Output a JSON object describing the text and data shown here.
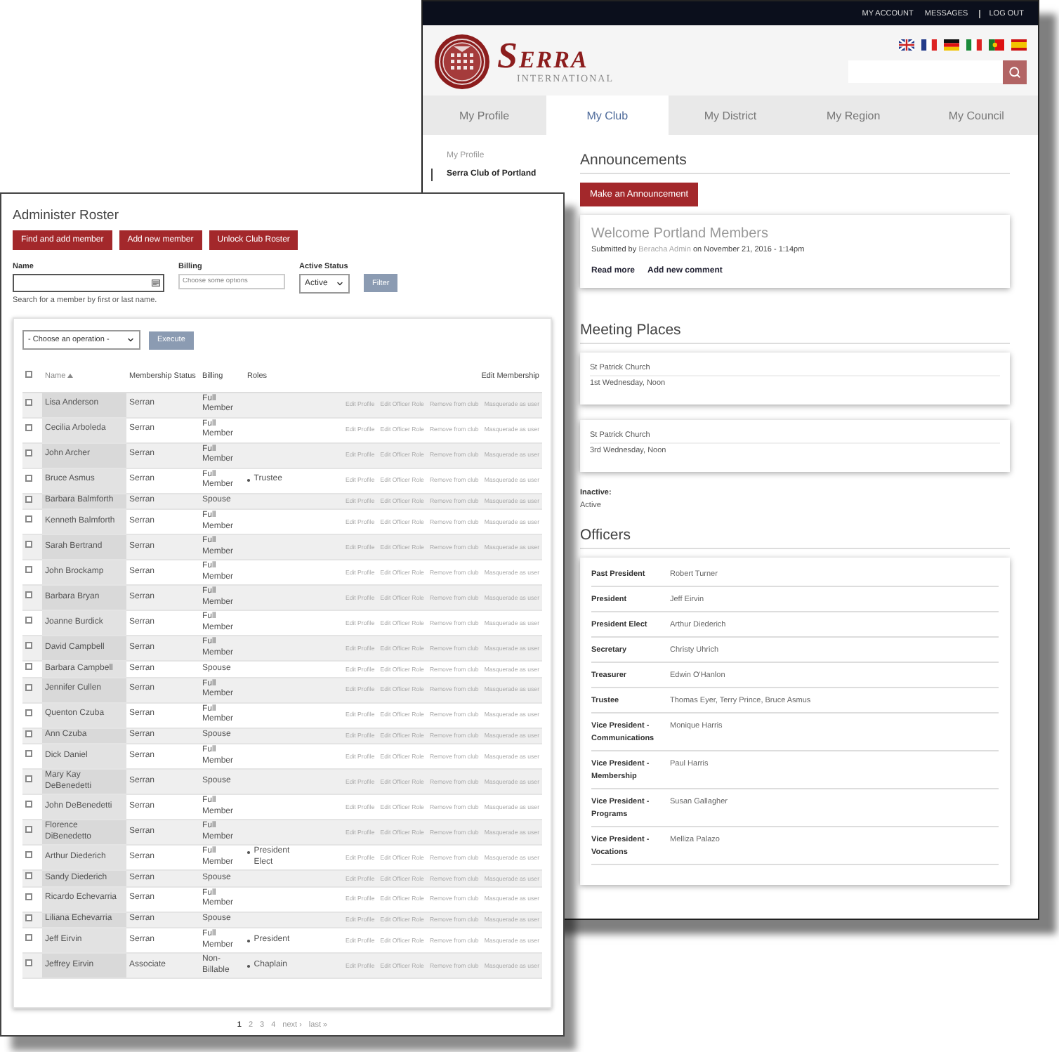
{
  "account_window": {
    "top_links": [
      "MY ACCOUNT",
      "MESSAGES",
      "LOG OUT"
    ],
    "logo": {
      "wordmark": "SERRA",
      "subtitle": "INTERNATIONAL"
    },
    "tabs": [
      {
        "label": "My Profile",
        "selected": false
      },
      {
        "label": "My Club",
        "selected": true
      },
      {
        "label": "My District",
        "selected": false
      },
      {
        "label": "My Region",
        "selected": false
      },
      {
        "label": "My Council",
        "selected": false
      }
    ],
    "sidebar": {
      "items": [
        {
          "label": "My Profile",
          "selected": false
        },
        {
          "label": "Serra Club of Portland",
          "selected": true
        }
      ]
    },
    "announcements": {
      "heading": "Announcements",
      "button": "Make an Announcement",
      "items": [
        {
          "title": "Welcome Portland Members",
          "submitted_prefix": "Submitted by",
          "author": "Beracha Admin",
          "submitted_suffix": "on November 21, 2016 - 1:14pm",
          "links": [
            "Read more",
            "Add new comment"
          ]
        }
      ]
    },
    "meeting_places": {
      "heading": "Meeting Places",
      "items": [
        {
          "place": "St Patrick Church",
          "schedule": "1st Wednesday, Noon"
        },
        {
          "place": "St Patrick Church",
          "schedule": "3rd Wednesday, Noon"
        }
      ]
    },
    "inactive": {
      "label": "Inactive:",
      "value": "Active"
    },
    "officers": {
      "heading": "Officers",
      "items": [
        {
          "role": "Past President",
          "name": "Robert Turner"
        },
        {
          "role": "President",
          "name": "Jeff Eirvin"
        },
        {
          "role": "President Elect",
          "name": "Arthur Diederich"
        },
        {
          "role": "Secretary",
          "name": "Christy Uhrich"
        },
        {
          "role": "Treasurer",
          "name": "Edwin O'Hanlon"
        },
        {
          "role": "Trustee",
          "name": "Thomas Eyer, Terry Prince, Bruce Asmus"
        },
        {
          "role": "Vice President - Communications",
          "name": "Monique Harris"
        },
        {
          "role": "Vice President - Membership",
          "name": "Paul Harris"
        },
        {
          "role": "Vice President - Programs",
          "name": "Susan Gallagher"
        },
        {
          "role": "Vice President - Vocations",
          "name": "Melliza Palazo"
        }
      ]
    }
  },
  "roster_window": {
    "title": "Administer Roster",
    "buttons": [
      "Find and add member",
      "Add new member",
      "Unlock Club Roster"
    ],
    "filters": {
      "name_label": "Name",
      "name_hint": "Search for a member by first or last name.",
      "billing_label": "Billing",
      "billing_placeholder": "Choose some options",
      "status_label": "Active Status",
      "status_value": "Active",
      "filter_button": "Filter"
    },
    "operation": {
      "value": "- Choose an operation -",
      "button": "Execute"
    },
    "table": {
      "select_all_checked": false,
      "columns": [
        {
          "label": "Name",
          "sorted": true
        },
        {
          "label": "Membership Status",
          "sorted": false
        },
        {
          "label": "Billing",
          "sorted": false
        },
        {
          "label": "Roles",
          "sorted": false
        },
        {
          "label": "Edit Membership",
          "sorted": false
        }
      ],
      "rows": [
        {
          "checked": false,
          "name": "Lisa Anderson",
          "status": "Serran",
          "billing": "Full Member",
          "actions": [
            "Edit Profile",
            "Edit Officer Role",
            "Remove from club",
            "Masquerade as user"
          ]
        },
        {
          "checked": false,
          "name": "Cecilia Arboleda",
          "status": "Serran",
          "billing": "Full Member",
          "actions": [
            "Edit Profile",
            "Edit Officer Role",
            "Remove from club",
            "Masquerade as user"
          ]
        },
        {
          "checked": false,
          "name": "John Archer",
          "status": "Serran",
          "billing": "Full Member",
          "actions": [
            "Edit Profile",
            "Edit Officer Role",
            "Remove from club",
            "Masquerade as user"
          ]
        },
        {
          "checked": false,
          "name": "Bruce Asmus",
          "status": "Serran",
          "billing": "Full Member",
          "roles": [
            "Trustee"
          ],
          "actions": [
            "Edit Profile",
            "Edit Officer Role",
            "Remove from club",
            "Masquerade as user"
          ]
        },
        {
          "checked": false,
          "name": "Barbara Balmforth",
          "status": "Serran",
          "billing": "Spouse",
          "actions": [
            "Edit Profile",
            "Edit Officer Role",
            "Remove from club",
            "Masquerade as user"
          ]
        },
        {
          "checked": false,
          "name": "Kenneth Balmforth",
          "status": "Serran",
          "billing": "Full Member",
          "actions": [
            "Edit Profile",
            "Edit Officer Role",
            "Remove from club",
            "Masquerade as user"
          ]
        },
        {
          "checked": false,
          "name": "Sarah Bertrand",
          "status": "Serran",
          "billing": "Full Member",
          "actions": [
            "Edit Profile",
            "Edit Officer Role",
            "Remove from club",
            "Masquerade as user"
          ]
        },
        {
          "checked": false,
          "name": "John Brockamp",
          "status": "Serran",
          "billing": "Full Member",
          "actions": [
            "Edit Profile",
            "Edit Officer Role",
            "Remove from club",
            "Masquerade as user"
          ]
        },
        {
          "checked": false,
          "name": "Barbara Bryan",
          "status": "Serran",
          "billing": "Full Member",
          "actions": [
            "Edit Profile",
            "Edit Officer Role",
            "Remove from club",
            "Masquerade as user"
          ]
        },
        {
          "checked": false,
          "name": "Joanne Burdick",
          "status": "Serran",
          "billing": "Full Member",
          "actions": [
            "Edit Profile",
            "Edit Officer Role",
            "Remove from club",
            "Masquerade as user"
          ]
        },
        {
          "checked": false,
          "name": "David Campbell",
          "status": "Serran",
          "billing": "Full Member",
          "actions": [
            "Edit Profile",
            "Edit Officer Role",
            "Remove from club",
            "Masquerade as user"
          ]
        },
        {
          "checked": false,
          "name": "Barbara Campbell",
          "status": "Serran",
          "billing": "Spouse",
          "actions": [
            "Edit Profile",
            "Edit Officer Role",
            "Remove from club",
            "Masquerade as user"
          ]
        },
        {
          "checked": false,
          "name": "Jennifer Cullen",
          "status": "Serran",
          "billing": "Full Member",
          "actions": [
            "Edit Profile",
            "Edit Officer Role",
            "Remove from club",
            "Masquerade as user"
          ]
        },
        {
          "checked": false,
          "name": "Quenton Czuba",
          "status": "Serran",
          "billing": "Full Member",
          "actions": [
            "Edit Profile",
            "Edit Officer Role",
            "Remove from club",
            "Masquerade as user"
          ]
        },
        {
          "checked": false,
          "name": "Ann Czuba",
          "status": "Serran",
          "billing": "Spouse",
          "actions": [
            "Edit Profile",
            "Edit Officer Role",
            "Remove from club",
            "Masquerade as user"
          ]
        },
        {
          "checked": false,
          "name": "Dick Daniel",
          "status": "Serran",
          "billing": "Full Member",
          "actions": [
            "Edit Profile",
            "Edit Officer Role",
            "Remove from club",
            "Masquerade as user"
          ]
        },
        {
          "checked": false,
          "name": "Mary Kay DeBenedetti",
          "status": "Serran",
          "billing": "Spouse",
          "actions": [
            "Edit Profile",
            "Edit Officer Role",
            "Remove from club",
            "Masquerade as user"
          ]
        },
        {
          "checked": false,
          "name": "John DeBenedetti",
          "status": "Serran",
          "billing": "Full Member",
          "actions": [
            "Edit Profile",
            "Edit Officer Role",
            "Remove from club",
            "Masquerade as user"
          ]
        },
        {
          "checked": false,
          "name": "Florence DiBenedetto",
          "status": "Serran",
          "billing": "Full Member",
          "actions": [
            "Edit Profile",
            "Edit Officer Role",
            "Remove from club",
            "Masquerade as user"
          ]
        },
        {
          "checked": false,
          "name": "Arthur Diederich",
          "status": "Serran",
          "billing": "Full Member",
          "roles": [
            "President Elect"
          ],
          "actions": [
            "Edit Profile",
            "Edit Officer Role",
            "Remove from club",
            "Masquerade as user"
          ]
        },
        {
          "checked": false,
          "name": "Sandy Diederich",
          "status": "Serran",
          "billing": "Spouse",
          "actions": [
            "Edit Profile",
            "Edit Officer Role",
            "Remove from club",
            "Masquerade as user"
          ]
        },
        {
          "checked": false,
          "name": "Ricardo Echevarria",
          "status": "Serran",
          "billing": "Full Member",
          "actions": [
            "Edit Profile",
            "Edit Officer Role",
            "Remove from club",
            "Masquerade as user"
          ]
        },
        {
          "checked": false,
          "name": "Liliana Echevarria",
          "status": "Serran",
          "billing": "Spouse",
          "actions": [
            "Edit Profile",
            "Edit Officer Role",
            "Remove from club",
            "Masquerade as user"
          ]
        },
        {
          "checked": false,
          "name": "Jeff Eirvin",
          "status": "Serran",
          "billing": "Full Member",
          "roles": [
            "President"
          ],
          "actions": [
            "Edit Profile",
            "Edit Officer Role",
            "Remove from club",
            "Masquerade as user"
          ]
        },
        {
          "checked": false,
          "name": "Jeffrey Eirvin",
          "status": "Associate",
          "billing": "Non-Billable",
          "roles": [
            "Chaplain"
          ],
          "actions": [
            "Edit Profile",
            "Edit Officer Role",
            "Remove from club",
            "Masquerade as user"
          ]
        }
      ]
    },
    "pagination": {
      "pages": [
        {
          "label": "1",
          "selected": true
        },
        {
          "label": "2",
          "selected": false
        },
        {
          "label": "3",
          "selected": false
        },
        {
          "label": "4",
          "selected": false
        }
      ],
      "next": "next ›",
      "last": "last »"
    }
  }
}
